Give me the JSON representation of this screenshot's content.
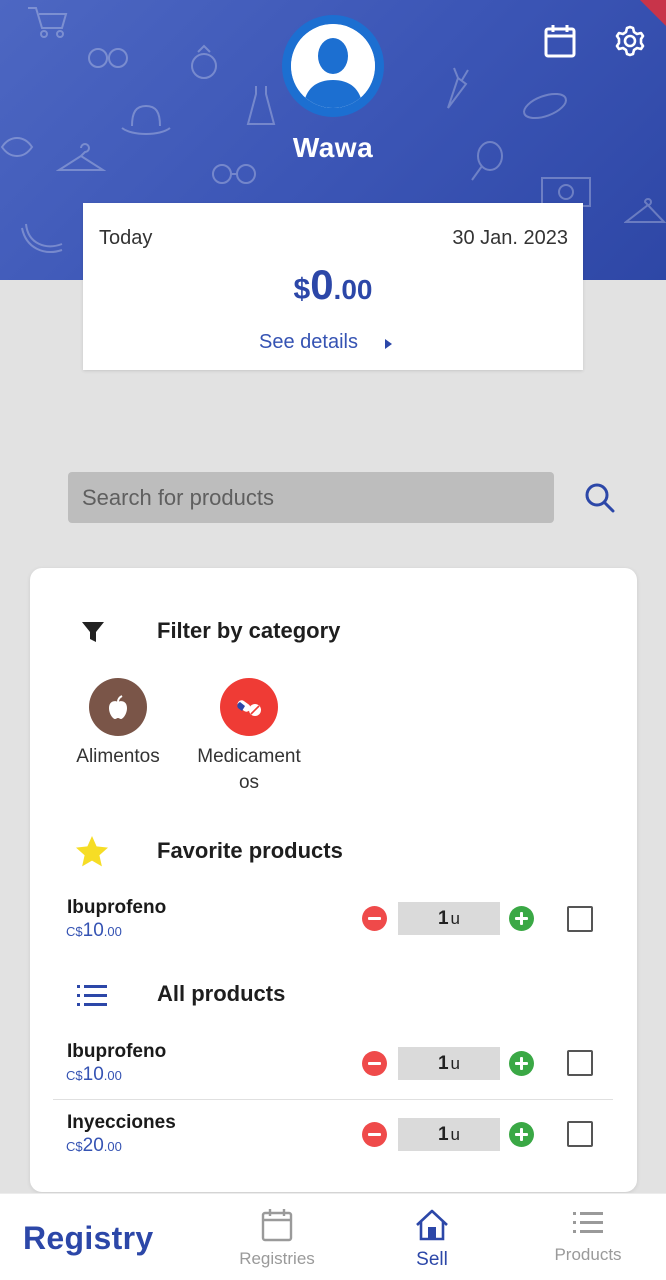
{
  "header": {
    "username": "Wawa",
    "calendar_icon": "calendar-icon",
    "settings_icon": "gear-icon",
    "avatar_icon": "user-silhouette-icon"
  },
  "summary": {
    "day_label": "Today",
    "date": "30 Jan. 2023",
    "amount_currency": "$",
    "amount_integer": "0",
    "amount_cents": ".00",
    "details_link": "See details"
  },
  "search": {
    "placeholder": "Search for products",
    "icon": "search-icon"
  },
  "filter": {
    "title": "Filter by category",
    "icon": "funnel-icon",
    "categories": [
      {
        "label": "Alimentos",
        "icon": "apple-icon",
        "color": "#7a5548"
      },
      {
        "label": "Medicamentos",
        "icon": "pills-icon",
        "color": "#ef3b35"
      }
    ]
  },
  "favorites": {
    "title": "Favorite products",
    "icon": "star-icon",
    "items": [
      {
        "name": "Ibuprofeno",
        "currency": "C$",
        "price_int": "10",
        "price_dec": ".00",
        "qty": "1",
        "unit": "u"
      }
    ]
  },
  "all_products": {
    "title": "All products",
    "icon": "list-icon",
    "items": [
      {
        "name": "Ibuprofeno",
        "currency": "C$",
        "price_int": "10",
        "price_dec": ".00",
        "qty": "1",
        "unit": "u"
      },
      {
        "name": "Inyecciones",
        "currency": "C$",
        "price_int": "20",
        "price_dec": ".00",
        "qty": "1",
        "unit": "u"
      }
    ]
  },
  "bottom_nav": {
    "brand": "Registry",
    "items": [
      {
        "label": "Registries",
        "icon": "calendar-icon"
      },
      {
        "label": "Sell",
        "icon": "home-icon",
        "active": true
      },
      {
        "label": "Products",
        "icon": "list-icon"
      }
    ]
  },
  "colors": {
    "brand_blue": "#2c47a8",
    "header_blue": "#3c56b6",
    "minus_red": "#ef4a4a",
    "plus_green": "#3aa845"
  }
}
